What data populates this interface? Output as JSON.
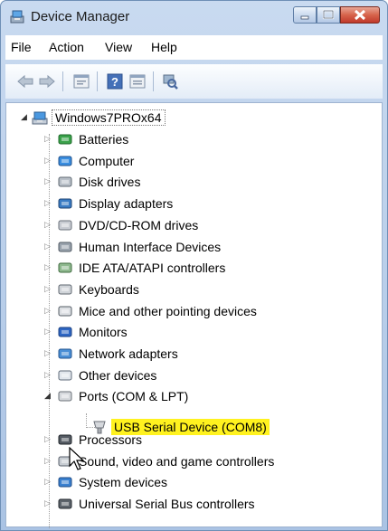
{
  "window": {
    "title": "Device Manager"
  },
  "menubar": {
    "items": [
      "File",
      "Action",
      "View",
      "Help"
    ]
  },
  "toolbar": {
    "buttons": [
      "back-icon",
      "forward-icon",
      "properties-icon",
      "help-icon",
      "update-driver-icon",
      "scan-hardware-icon"
    ]
  },
  "tree": {
    "root": "Windows7PROx64",
    "categories": [
      {
        "label": "Batteries",
        "icon": "battery-icon",
        "expanded": false
      },
      {
        "label": "Computer",
        "icon": "computer-icon",
        "expanded": false
      },
      {
        "label": "Disk drives",
        "icon": "disk-drive-icon",
        "expanded": false
      },
      {
        "label": "Display adapters",
        "icon": "display-adapter-icon",
        "expanded": false
      },
      {
        "label": "DVD/CD-ROM drives",
        "icon": "dvd-drive-icon",
        "expanded": false
      },
      {
        "label": "Human Interface Devices",
        "icon": "hid-icon",
        "expanded": false
      },
      {
        "label": "IDE ATA/ATAPI controllers",
        "icon": "ide-controller-icon",
        "expanded": false
      },
      {
        "label": "Keyboards",
        "icon": "keyboard-icon",
        "expanded": false
      },
      {
        "label": "Mice and other pointing devices",
        "icon": "mouse-icon",
        "expanded": false
      },
      {
        "label": "Monitors",
        "icon": "monitor-icon",
        "expanded": false
      },
      {
        "label": "Network adapters",
        "icon": "network-adapter-icon",
        "expanded": false
      },
      {
        "label": "Other devices",
        "icon": "other-devices-icon",
        "expanded": false
      },
      {
        "label": "Ports (COM & LPT)",
        "icon": "port-icon",
        "expanded": true
      },
      {
        "label": "Processors",
        "icon": "processor-icon",
        "expanded": false
      },
      {
        "label": "Sound, video and game controllers",
        "icon": "sound-icon",
        "expanded": false
      },
      {
        "label": "System devices",
        "icon": "system-devices-icon",
        "expanded": false
      },
      {
        "label": "Universal Serial Bus controllers",
        "icon": "usb-icon",
        "expanded": false
      }
    ],
    "ports_child": {
      "label": "USB Serial Device (COM8)",
      "highlight_color": "#fff21f"
    }
  }
}
